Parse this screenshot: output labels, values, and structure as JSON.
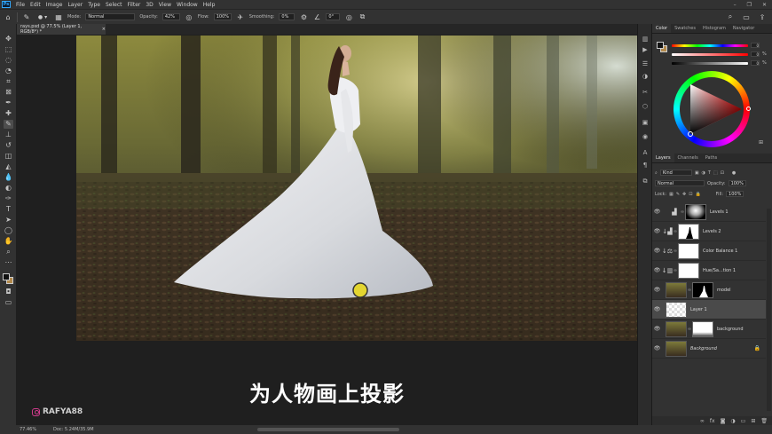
{
  "menu": {
    "app_icon": "Ps",
    "items": [
      "File",
      "Edit",
      "Image",
      "Layer",
      "Type",
      "Select",
      "Filter",
      "3D",
      "View",
      "Window",
      "Help"
    ],
    "window_buttons": [
      "–",
      "❐",
      "✕"
    ]
  },
  "options_bar": {
    "mode_label": "Mode:",
    "mode_value": "Normal",
    "opacity_label": "Opacity:",
    "opacity_value": "42%",
    "flow_label": "Flow:",
    "flow_value": "100%",
    "smoothing_label": "Smoothing:",
    "smoothing_value": "0%",
    "angle_value": "0°"
  },
  "document_tab": {
    "title": "rays.psd @ 77.5% (Layer 1, RGB/8*) *",
    "close": "×"
  },
  "canvas": {
    "caption": "为人物画上投影",
    "watermark": "RAFYA88"
  },
  "status_bar": {
    "zoom": "77.46%",
    "doc": "Doc: 5.24M/35.9M"
  },
  "color_panel": {
    "tabs": [
      "Color",
      "Swatches",
      "Histogram",
      "Navigator"
    ],
    "values": [
      "0",
      "0",
      "0"
    ],
    "units": [
      "",
      "%",
      "%"
    ]
  },
  "layers_panel": {
    "tabs": [
      "Layers",
      "Channels",
      "Paths"
    ],
    "filter_kind": "Kind",
    "blend_mode": "Normal",
    "opacity_label": "Opacity:",
    "opacity_value": "100%",
    "lock_label": "Lock:",
    "fill_label": "Fill:",
    "fill_value": "100%",
    "layers": [
      {
        "name": "Levels 1",
        "type": "adjustment",
        "icon": "levels-icon",
        "mask": "radial",
        "selected": false
      },
      {
        "name": "Levels 2",
        "type": "adjustment",
        "icon": "levels-icon",
        "mask": "silhouette",
        "selected": false
      },
      {
        "name": "Color Balance 1",
        "type": "adjustment",
        "icon": "balance-icon",
        "mask": "white",
        "selected": false
      },
      {
        "name": "Hue/Sa...tion 1",
        "type": "adjustment",
        "icon": "hue-icon",
        "mask": "white",
        "selected": false
      },
      {
        "name": "model",
        "type": "pixel",
        "mask": "silhouette-black",
        "selected": false
      },
      {
        "name": "Layer 1",
        "type": "transparent",
        "selected": true
      },
      {
        "name": "background",
        "type": "pixel",
        "mask": "white-dark",
        "selected": false
      },
      {
        "name": "Background",
        "type": "pixel",
        "locked": true,
        "selected": false
      }
    ]
  },
  "colors": {
    "foreground": "#111111",
    "background": "#b38a4c",
    "ui_bg": "#323232",
    "accent": "#31a8ff"
  }
}
